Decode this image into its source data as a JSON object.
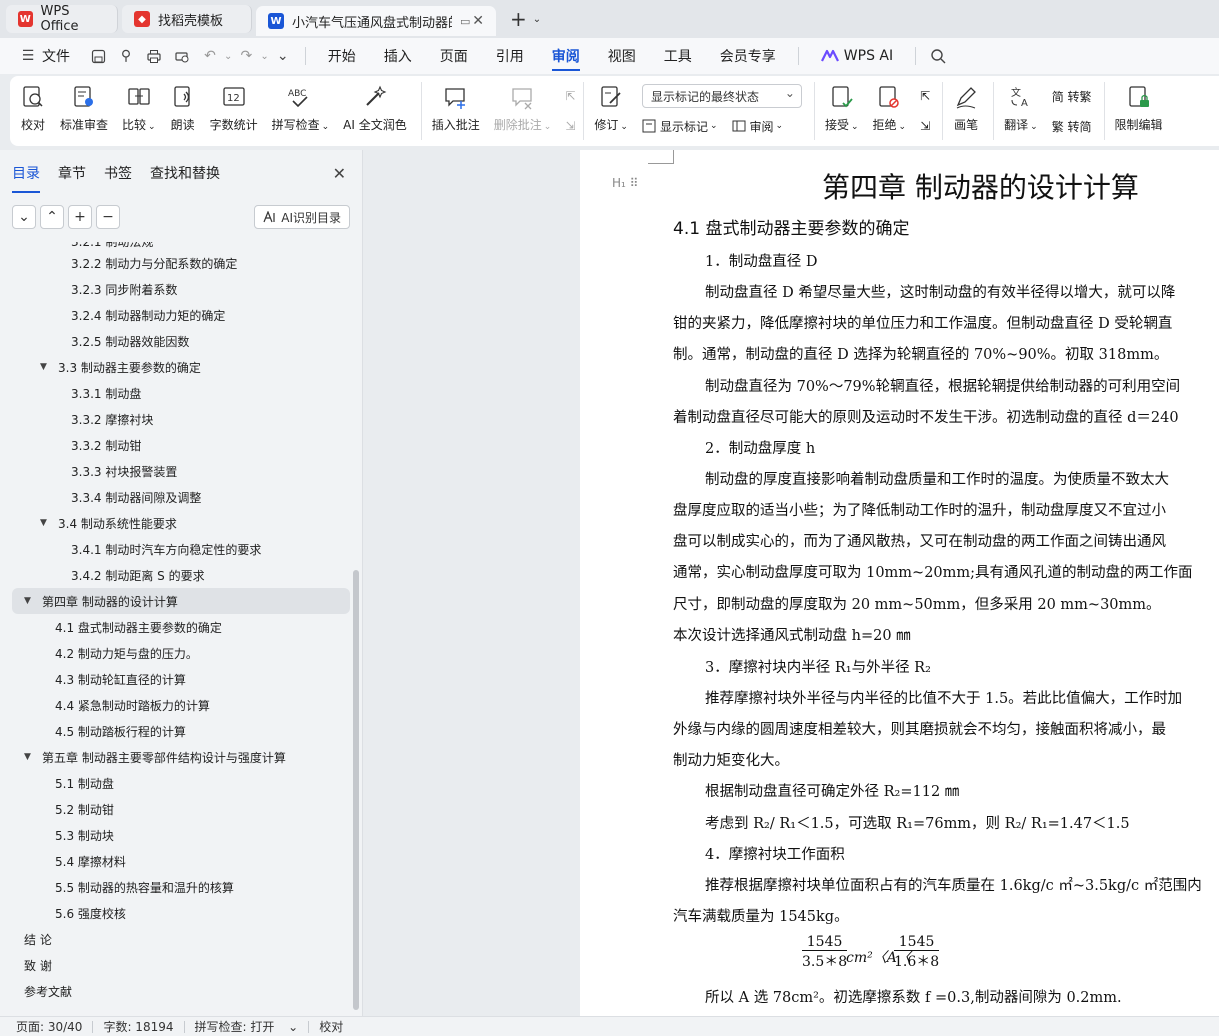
{
  "tabs": [
    {
      "label": "WPS Office",
      "color": "#e4352f"
    },
    {
      "label": "找稻壳模板",
      "color": "#e4352f"
    },
    {
      "label": "小汽车气压通风盘式制动器的",
      "color": "#1a56d6"
    }
  ],
  "menu": {
    "file": "文件",
    "items": [
      "开始",
      "插入",
      "页面",
      "引用",
      "审阅",
      "视图",
      "工具",
      "会员专享"
    ],
    "active": "审阅",
    "wps_ai": "WPS AI"
  },
  "ribbon": {
    "proofread": "校对",
    "std_review": "标准审查",
    "compare": "比较",
    "read_aloud": "朗读",
    "word_count": "字数统计",
    "spell_check": "拼写检查",
    "ai_polish": "AI 全文润色",
    "insert_comment": "插入批注",
    "delete_comment": "删除批注",
    "markup_select": "显示标记的最终状态",
    "revise": "修订",
    "show_markup": "显示标记",
    "review": "审阅",
    "accept": "接受",
    "reject": "拒绝",
    "pen": "画笔",
    "translate": "翻译",
    "to_trad": "简 转繁",
    "to_simp": "繁 转简",
    "restrict_edit": "限制编辑"
  },
  "nav": {
    "tabs": [
      "目录",
      "章节",
      "书签",
      "查找和替换"
    ],
    "ai_button": "AI识别目录",
    "toc": [
      {
        "label": "3.2.1 制动法规",
        "level": 3
      },
      {
        "label": "3.2.2 制动力与分配系数的确定",
        "level": 3
      },
      {
        "label": "3.2.3 同步附着系数",
        "level": 3
      },
      {
        "label": "3.2.4 制动器制动力矩的确定",
        "level": 3
      },
      {
        "label": "3.2.5 制动器效能因数",
        "level": 3
      },
      {
        "label": "3.3 制动器主要参数的确定",
        "level": 2,
        "open": true
      },
      {
        "label": "3.3.1 制动盘",
        "level": 3
      },
      {
        "label": "3.3.2 摩擦衬块",
        "level": 3
      },
      {
        "label": "3.3.2 制动钳",
        "level": 3
      },
      {
        "label": "3.3.3 衬块报警装置",
        "level": 3
      },
      {
        "label": "3.3.4 制动器间隙及调整",
        "level": 3
      },
      {
        "label": "3.4 制动系统性能要求",
        "level": 2,
        "open": true
      },
      {
        "label": "3.4.1 制动时汽车方向稳定性的要求",
        "level": 3
      },
      {
        "label": "3.4.2 制动距离 S 的要求",
        "level": 3
      },
      {
        "label": "第四章  制动器的设计计算",
        "level": 1,
        "open": true,
        "selected": true
      },
      {
        "label": "4.1  盘式制动器主要参数的确定",
        "level": 2
      },
      {
        "label": "4.2  制动力矩与盘的压力。",
        "level": 2
      },
      {
        "label": "4.3  制动轮缸直径的计算",
        "level": 2
      },
      {
        "label": "4.4  紧急制动时踏板力的计算",
        "level": 2
      },
      {
        "label": "4.5  制动踏板行程的计算",
        "level": 2
      },
      {
        "label": "第五章  制动器主要零部件结构设计与强度计算",
        "level": 1,
        "open": true
      },
      {
        "label": "5.1  制动盘",
        "level": 2
      },
      {
        "label": "5.2  制动钳",
        "level": 2
      },
      {
        "label": "5.3  制动块",
        "level": 2
      },
      {
        "label": "5.4  摩擦材料",
        "level": 2
      },
      {
        "label": "5.5  制动器的热容量和温升的核算",
        "level": 2
      },
      {
        "label": "5.6  强度校核",
        "level": 2
      },
      {
        "label": "结  论",
        "level": 1
      },
      {
        "label": "致  谢",
        "level": 1
      },
      {
        "label": "参考文献",
        "level": 1
      }
    ]
  },
  "doc": {
    "chapter_title": "第四章  制动器的设计计算",
    "h_marker": "H",
    "lines": [
      {
        "text": "4.1  盘式制动器主要参数的确定",
        "indent": false,
        "heading": true
      },
      {
        "text": "1．制动盘直径 D",
        "indent": true
      },
      {
        "text": "制动盘直径 D 希望尽量大些，这时制动盘的有效半径得以增大，就可以降",
        "indent": true
      },
      {
        "text": "钳的夹紧力，降低摩擦衬块的单位压力和工作温度。但制动盘直径 D 受轮辋直",
        "indent": false
      },
      {
        "text": "制。通常，制动盘的直径 D 选择为轮辋直径的 70%~90%。初取 318mm。",
        "indent": false
      },
      {
        "text": "制动盘直径为 70%～79%轮辋直径，根据轮辋提供给制动器的可利用空间",
        "indent": true
      },
      {
        "text": "着制动盘直径尽可能大的原则及运动时不发生干涉。初选制动盘的直径 d＝240",
        "indent": false
      },
      {
        "text": "2．制动盘厚度 h",
        "indent": true
      },
      {
        "text": "制动盘的厚度直接影响着制动盘质量和工作时的温度。为使质量不致太大",
        "indent": true
      },
      {
        "text": "盘厚度应取的适当小些；为了降低制动工作时的温升，制动盘厚度又不宜过小",
        "indent": false
      },
      {
        "text": "盘可以制成实心的，而为了通风散热，又可在制动盘的两工作面之间铸出通风",
        "indent": false
      },
      {
        "text": "通常，实心制动盘厚度可取为 10mm~20mm;具有通风孔道的制动盘的两工作面",
        "indent": false
      },
      {
        "text": "尺寸，即制动盘的厚度取为 20 mm~50mm，但多采用 20 mm~30mm。",
        "indent": false
      },
      {
        "text": "本次设计选择通风式制动盘 h=20 ㎜",
        "indent": false
      },
      {
        "text": "3．摩擦衬块内半径 R₁与外半径 R₂",
        "indent": true
      },
      {
        "text": "推荐摩擦衬块外半径与内半径的比值不大于 1.5。若此比值偏大，工作时加",
        "indent": true
      },
      {
        "text": "外缘与内缘的圆周速度相差较大，则其磨损就会不均匀，接触面积将减小，最",
        "indent": false
      },
      {
        "text": "制动力矩变化大。",
        "indent": false
      },
      {
        "text": "根据制动盘直径可确定外径 R₂=112 ㎜",
        "indent": true
      },
      {
        "text": "考虑到 R₂/ R₁＜1.5，可选取 R₁=76mm，则 R₂/ R₁=1.47＜1.5",
        "indent": true
      },
      {
        "text": "4．摩擦衬块工作面积",
        "indent": true
      },
      {
        "text": "推荐根据摩擦衬块单位面积占有的汽车质量在 1.6kg/c ㎡~3.5kg/c ㎡范围内",
        "indent": true
      },
      {
        "text": "汽车满载质量为 1545kg。",
        "indent": false
      }
    ],
    "formula": {
      "num1": "1545",
      "den1": "3.5＊8",
      "mid": "cm²〈A〈",
      "num2": "1545",
      "den2": "1.6＊8"
    },
    "last_line": "所以 A 选 78cm²。初选摩擦系数 f =0.3,制动器间隙为 0.2mm."
  },
  "status": {
    "page": "页面: 30/40",
    "words": "字数: 18194",
    "spell": "拼写检查: 打开",
    "proof": "校对"
  }
}
